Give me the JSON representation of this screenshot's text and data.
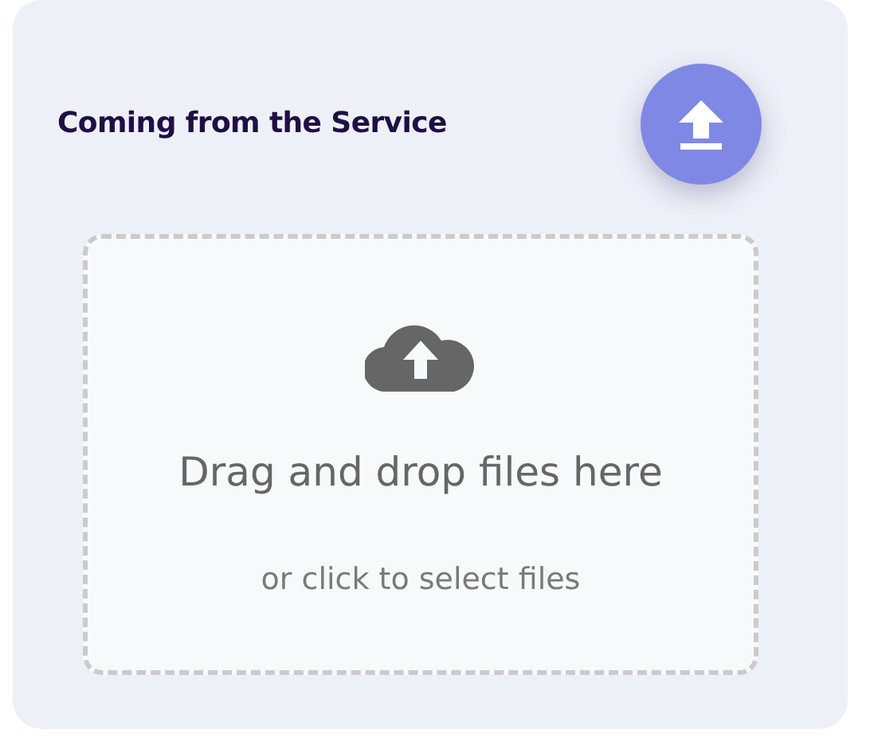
{
  "panel": {
    "title": "Coming from the Service"
  },
  "dropzone": {
    "heading": "Drag and drop files here",
    "hint": "or click to select files"
  }
}
